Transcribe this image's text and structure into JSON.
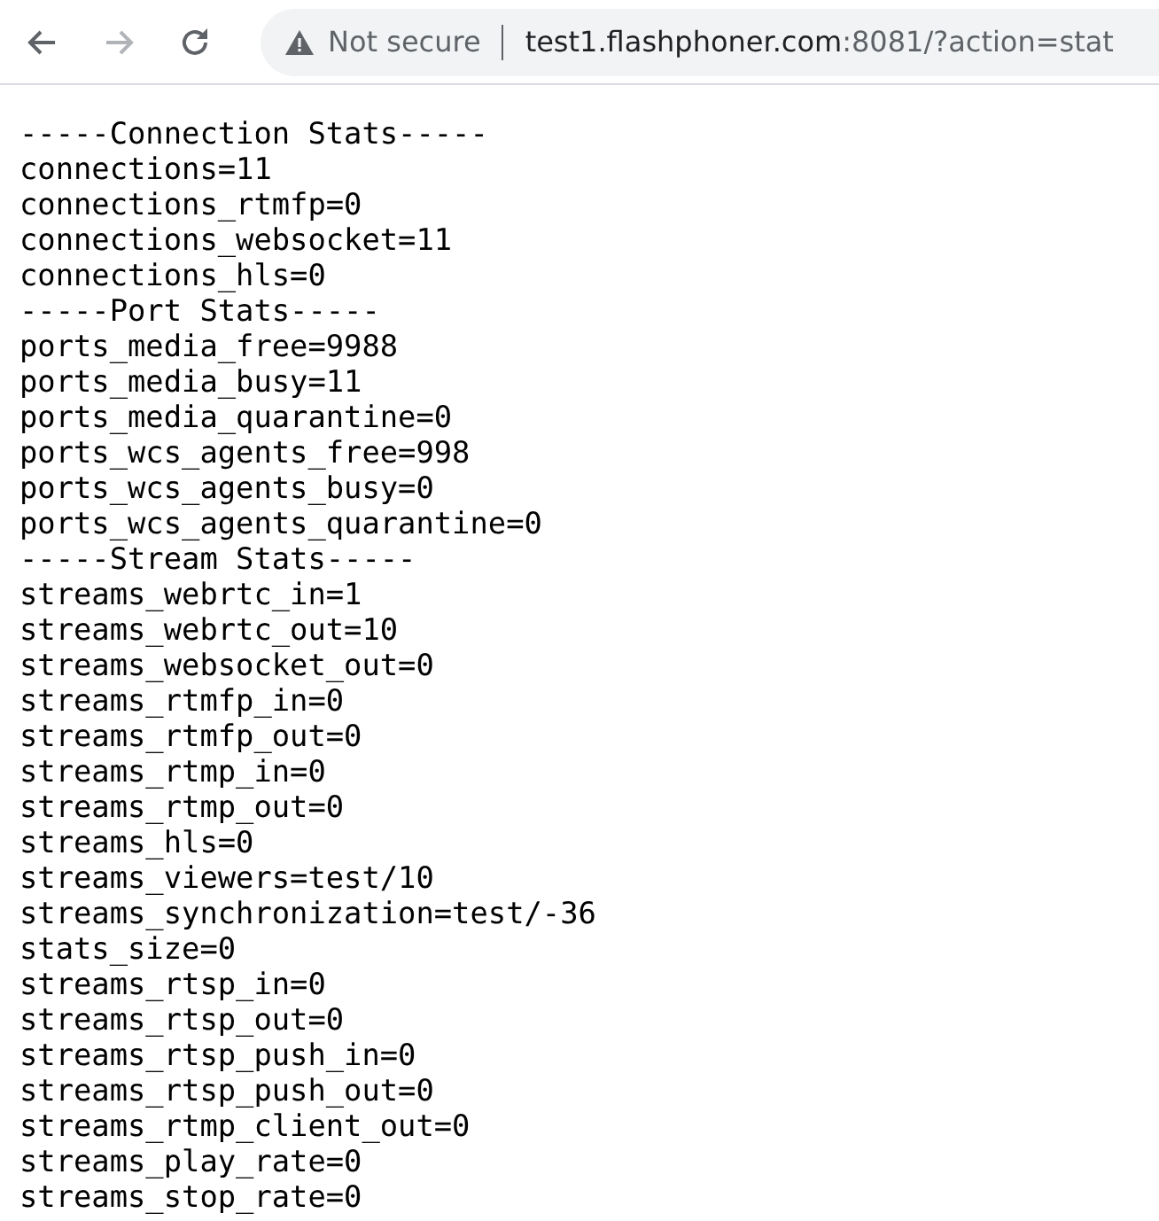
{
  "toolbar": {
    "nav_buttons": [
      {
        "kind": "back",
        "disabled": false
      },
      {
        "kind": "forward",
        "disabled": true
      },
      {
        "kind": "reload",
        "disabled": false
      }
    ],
    "address_bar": {
      "security": "Not secure",
      "host": "test1.flashphoner.com",
      "path": ":8081/?action=stat"
    }
  },
  "content": {
    "lines": [
      "-----Connection Stats-----",
      "connections=11",
      "connections_rtmfp=0",
      "connections_websocket=11",
      "connections_hls=0",
      "-----Port Stats-----",
      "ports_media_free=9988",
      "ports_media_busy=11",
      "ports_media_quarantine=0",
      "ports_wcs_agents_free=998",
      "ports_wcs_agents_busy=0",
      "ports_wcs_agents_quarantine=0",
      "-----Stream Stats-----",
      "streams_webrtc_in=1",
      "streams_webrtc_out=10",
      "streams_websocket_out=0",
      "streams_rtmfp_in=0",
      "streams_rtmfp_out=0",
      "streams_rtmp_in=0",
      "streams_rtmp_out=0",
      "streams_hls=0",
      "streams_viewers=test/10",
      "streams_synchronization=test/-36",
      "stats_size=0",
      "streams_rtsp_in=0",
      "streams_rtsp_out=0",
      "streams_rtsp_push_in=0",
      "streams_rtsp_push_out=0",
      "streams_rtmp_client_out=0",
      "streams_play_rate=0",
      "streams_stop_rate=0"
    ]
  }
}
